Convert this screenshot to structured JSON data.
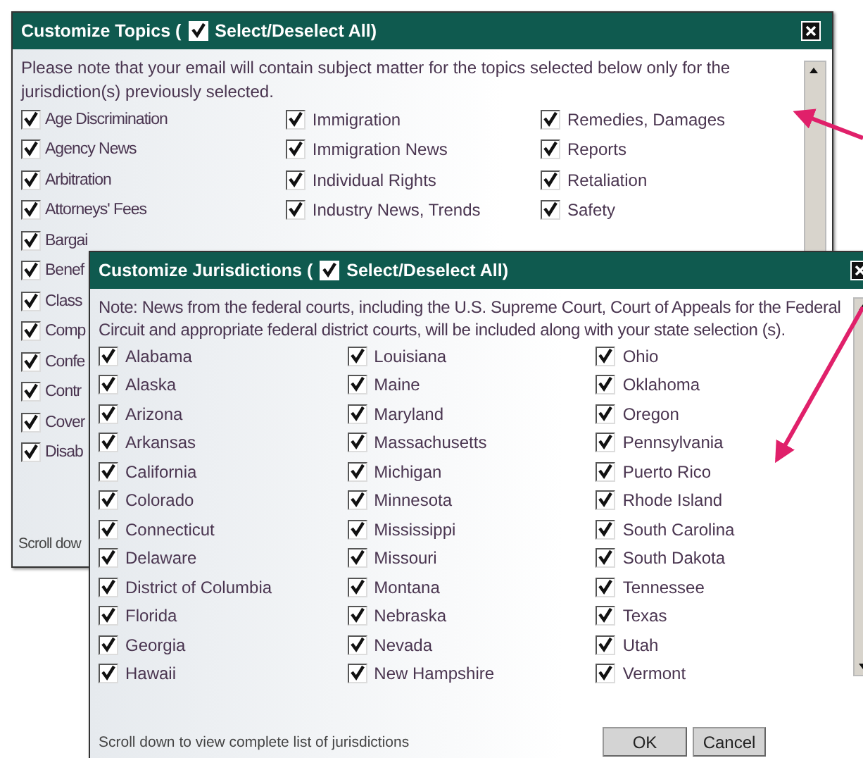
{
  "topics_dialog": {
    "title": "Customize Topics (",
    "select_all": {
      "label": "Select/Deselect All)",
      "checked": true
    },
    "note": "Please note that your email will contain subject matter for the topics selected below only for the jurisdiction(s) previously selected.",
    "columns": [
      [
        {
          "label": "Age Discrimination",
          "checked": true
        },
        {
          "label": "Agency News",
          "checked": true
        },
        {
          "label": "Arbitration",
          "checked": true
        },
        {
          "label": "Attorneys' Fees",
          "checked": true
        },
        {
          "label": "Bargai",
          "checked": true
        },
        {
          "label": "Benef",
          "checked": true
        },
        {
          "label": "Class",
          "checked": true
        },
        {
          "label": "Comp",
          "checked": true
        },
        {
          "label": "Confe",
          "checked": true
        },
        {
          "label": "Contr",
          "checked": true
        },
        {
          "label": "Cover",
          "checked": true
        },
        {
          "label": "Disab",
          "checked": true
        }
      ],
      [
        {
          "label": "Immigration",
          "checked": true
        },
        {
          "label": "Immigration News",
          "checked": true
        },
        {
          "label": "Individual Rights",
          "checked": true
        },
        {
          "label": "Industry News, Trends",
          "checked": true
        }
      ],
      [
        {
          "label": "Remedies, Damages",
          "checked": true
        },
        {
          "label": "Reports",
          "checked": true
        },
        {
          "label": "Retaliation",
          "checked": true
        },
        {
          "label": "Safety",
          "checked": true
        }
      ]
    ],
    "footer": "Scroll dow"
  },
  "jurisdictions_dialog": {
    "title": "Customize Jurisdictions (",
    "select_all": {
      "label": "Select/Deselect All)",
      "checked": true
    },
    "note": "Note: News from the federal courts, including the U.S. Supreme Court, Court of Appeals for the Federal Circuit and appropriate federal district courts, will be included along with your state selection (s).",
    "columns": [
      [
        {
          "label": "Alabama",
          "checked": true
        },
        {
          "label": "Alaska",
          "checked": true
        },
        {
          "label": "Arizona",
          "checked": true
        },
        {
          "label": "Arkansas",
          "checked": true
        },
        {
          "label": "California",
          "checked": true
        },
        {
          "label": "Colorado",
          "checked": true
        },
        {
          "label": "Connecticut",
          "checked": true
        },
        {
          "label": "Delaware",
          "checked": true
        },
        {
          "label": "District of Columbia",
          "checked": true
        },
        {
          "label": "Florida",
          "checked": true
        },
        {
          "label": "Georgia",
          "checked": true
        },
        {
          "label": "Hawaii",
          "checked": true
        }
      ],
      [
        {
          "label": "Louisiana",
          "checked": true
        },
        {
          "label": "Maine",
          "checked": true
        },
        {
          "label": "Maryland",
          "checked": true
        },
        {
          "label": "Massachusetts",
          "checked": true
        },
        {
          "label": "Michigan",
          "checked": true
        },
        {
          "label": "Minnesota",
          "checked": true
        },
        {
          "label": "Mississippi",
          "checked": true
        },
        {
          "label": "Missouri",
          "checked": true
        },
        {
          "label": "Montana",
          "checked": true
        },
        {
          "label": "Nebraska",
          "checked": true
        },
        {
          "label": "Nevada",
          "checked": true
        },
        {
          "label": "New Hampshire",
          "checked": true
        }
      ],
      [
        {
          "label": "Ohio",
          "checked": true
        },
        {
          "label": "Oklahoma",
          "checked": true
        },
        {
          "label": "Oregon",
          "checked": true
        },
        {
          "label": "Pennsylvania",
          "checked": true
        },
        {
          "label": "Puerto Rico",
          "checked": true
        },
        {
          "label": "Rhode Island",
          "checked": true
        },
        {
          "label": "South Carolina",
          "checked": true
        },
        {
          "label": "South Dakota",
          "checked": true
        },
        {
          "label": "Tennessee",
          "checked": true
        },
        {
          "label": "Texas",
          "checked": true
        },
        {
          "label": "Utah",
          "checked": true
        },
        {
          "label": "Vermont",
          "checked": true
        }
      ]
    ],
    "footer": "Scroll down to view complete list of jurisdictions",
    "buttons": [
      "OK",
      "Cancel"
    ]
  }
}
